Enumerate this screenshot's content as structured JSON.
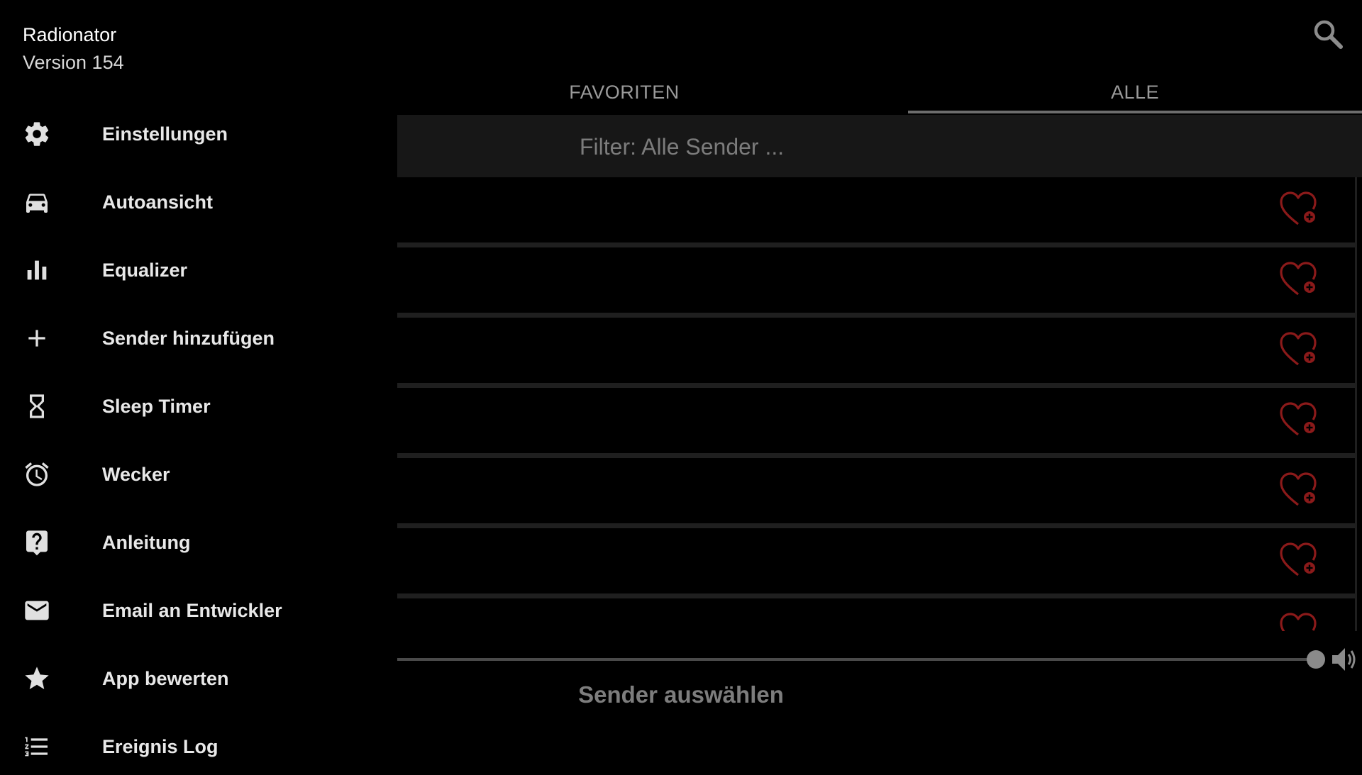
{
  "header": {
    "search_icon": "search-icon"
  },
  "tabs": [
    {
      "label": "FAVORITEN",
      "selected": false
    },
    {
      "label": "ALLE",
      "selected": true
    }
  ],
  "filter": {
    "placeholder": "Filter: Alle Sender ...",
    "value": ""
  },
  "station_list": {
    "favorite_add_icon": "heart-plus-icon",
    "rows": [
      {
        "name": ""
      },
      {
        "name": ""
      },
      {
        "name": ""
      },
      {
        "name": ""
      },
      {
        "name": ""
      },
      {
        "name": ""
      },
      {
        "name": ""
      },
      {
        "name": ""
      }
    ]
  },
  "player": {
    "status": "Sender auswählen",
    "volume_icon": "volume-icon"
  },
  "drawer": {
    "app_name": "Radionator",
    "version": "Version 154",
    "items": [
      {
        "label": "Einstellungen",
        "icon": "gear-icon"
      },
      {
        "label": "Autoansicht",
        "icon": "car-icon"
      },
      {
        "label": "Equalizer",
        "icon": "equalizer-icon"
      },
      {
        "label": "Sender hinzufügen",
        "icon": "plus-icon"
      },
      {
        "label": "Sleep Timer",
        "icon": "hourglass-icon"
      },
      {
        "label": "Wecker",
        "icon": "alarm-clock-icon"
      },
      {
        "label": "Anleitung",
        "icon": "help-icon"
      },
      {
        "label": "Email an Entwickler",
        "icon": "mail-icon"
      },
      {
        "label": "App bewerten",
        "icon": "star-icon"
      },
      {
        "label": "Ereignis Log",
        "icon": "list-numbered-icon"
      }
    ]
  },
  "colors": {
    "accent_favorite": "#8b1a1a",
    "background": "#000000",
    "drawer_text": "#e8e8e8",
    "dimmed_text": "#9a9a9a"
  }
}
